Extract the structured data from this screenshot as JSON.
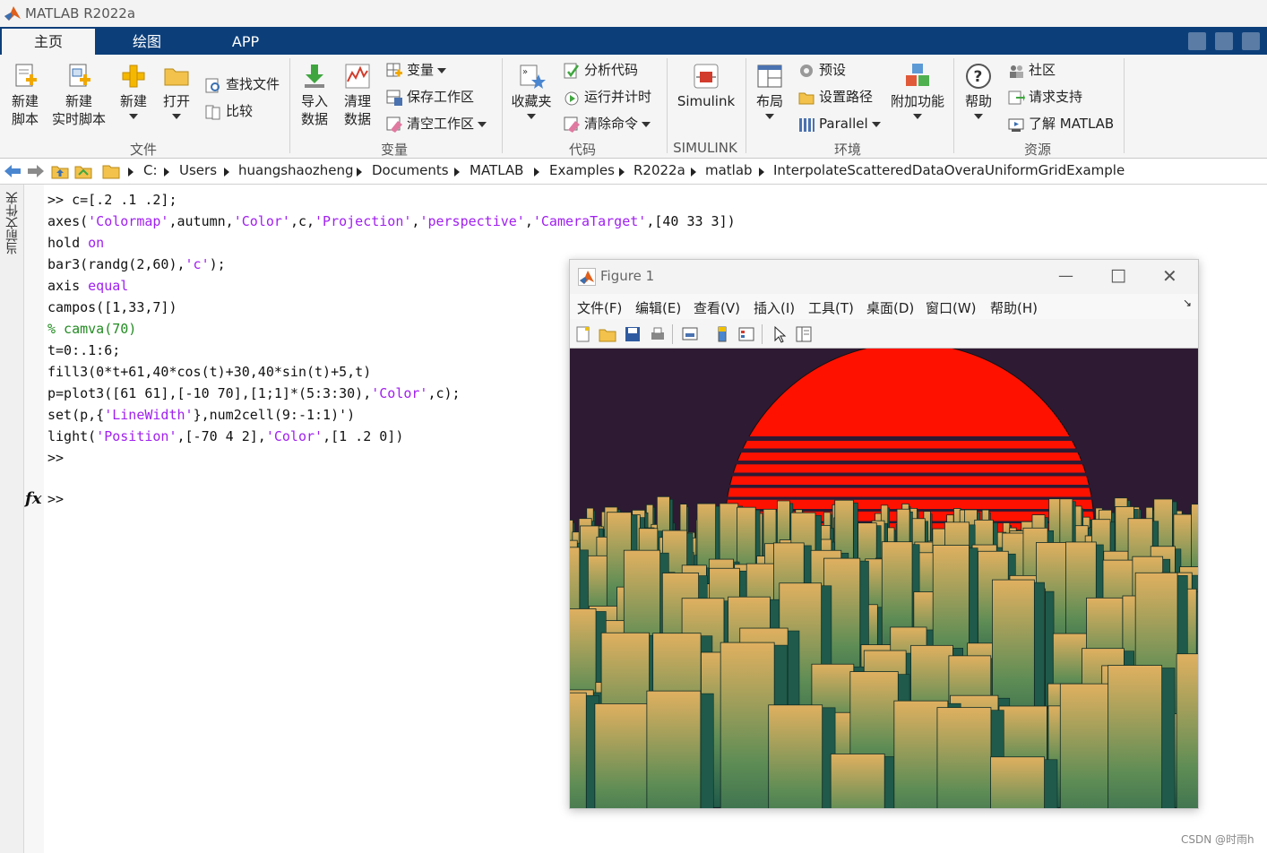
{
  "window": {
    "title": "MATLAB R2022a"
  },
  "tabs": [
    {
      "label": "主页",
      "active": true
    },
    {
      "label": "绘图",
      "active": false
    },
    {
      "label": "APP",
      "active": false
    }
  ],
  "ribbon": {
    "file": {
      "group_label": "文件",
      "new_script": [
        "新建",
        "脚本"
      ],
      "new_live_script": [
        "新建",
        "实时脚本"
      ],
      "new": "新建",
      "open": "打开",
      "find_files": "查找文件",
      "compare": "比较"
    },
    "variable": {
      "group_label": "变量",
      "import_data": [
        "导入",
        "数据"
      ],
      "clean_data": [
        "清理",
        "数据"
      ],
      "variable": "变量",
      "save_workspace": "保存工作区",
      "clear_workspace": "清空工作区"
    },
    "code": {
      "group_label": "代码",
      "favorites": "收藏夹",
      "analyze_code": "分析代码",
      "run_and_time": "运行并计时",
      "clear_commands": "清除命令"
    },
    "simulink": {
      "group_label": "SIMULINK",
      "simulink": "Simulink"
    },
    "environment": {
      "group_label": "环境",
      "layout": "布局",
      "preferences": "预设",
      "set_path": "设置路径",
      "parallel": "Parallel",
      "addons": "附加功能"
    },
    "resources": {
      "group_label": "资源",
      "help": "帮助",
      "community": "社区",
      "request_support": "请求支持",
      "learn_matlab": "了解 MATLAB"
    }
  },
  "address_bar": {
    "path": [
      "C:",
      "Users",
      "huangshaozheng",
      "Documents",
      "MATLAB",
      "Examples",
      "R2022a",
      "matlab",
      "InterpolateScatteredDataOveraUniformGridExample"
    ]
  },
  "side_panel": {
    "label": "当前文件夹"
  },
  "command_window": {
    "line1": ">> c=[.2 .1 .2];",
    "line2": {
      "a": "axes(",
      "s1": "'Colormap'",
      "b": ",autumn,",
      "s2": "'Color'",
      "c": ",c,",
      "s3": "'Projection'",
      "d": ",",
      "s4": "'perspective'",
      "e": ",",
      "s5": "'CameraTarget'",
      "f": ",[40 33 3])"
    },
    "line3": {
      "a": "hold ",
      "kw": "on"
    },
    "line4": {
      "a": "bar3(randg(2,60),",
      "s": "'c'",
      "b": ");"
    },
    "line5": {
      "a": "axis ",
      "kw": "equal"
    },
    "line6": "campos([1,33,7])",
    "line7": "% camva(70)",
    "line8": "t=0:.1:6;",
    "line9": "fill3(0*t+61,40*cos(t)+30,40*sin(t)+5,t)",
    "line10": {
      "a": "p=plot3([61 61],[-10 70],[1;1]*(5:3:30),",
      "s": "'Color'",
      "b": ",c);"
    },
    "line11": {
      "a": "set(p,{",
      "s": "'LineWidth'",
      "b": "},num2cell(9:-1:1)')"
    },
    "line12": {
      "a": "light(",
      "s1": "'Position'",
      "b": ",[-70 4 2],",
      "s2": "'Color'",
      "c": ",[1 .2 0])"
    },
    "line13": ">>",
    "fx": "fx",
    "prompt": ">>"
  },
  "figure": {
    "title": "Figure 1",
    "menu": [
      "文件(F)",
      "编辑(E)",
      "查看(V)",
      "插入(I)",
      "工具(T)",
      "桌面(D)",
      "窗口(W)",
      "帮助(H)"
    ],
    "colors": {
      "background": "#2e1a33",
      "sun": "#ff1100",
      "building_dark": "#1f5a4a",
      "building_light": "#e0b060"
    }
  },
  "watermark": "CSDN @时雨h",
  "colors": {
    "tabstrip": "#0c3f7a",
    "ribbon": "#f5f5f5"
  }
}
